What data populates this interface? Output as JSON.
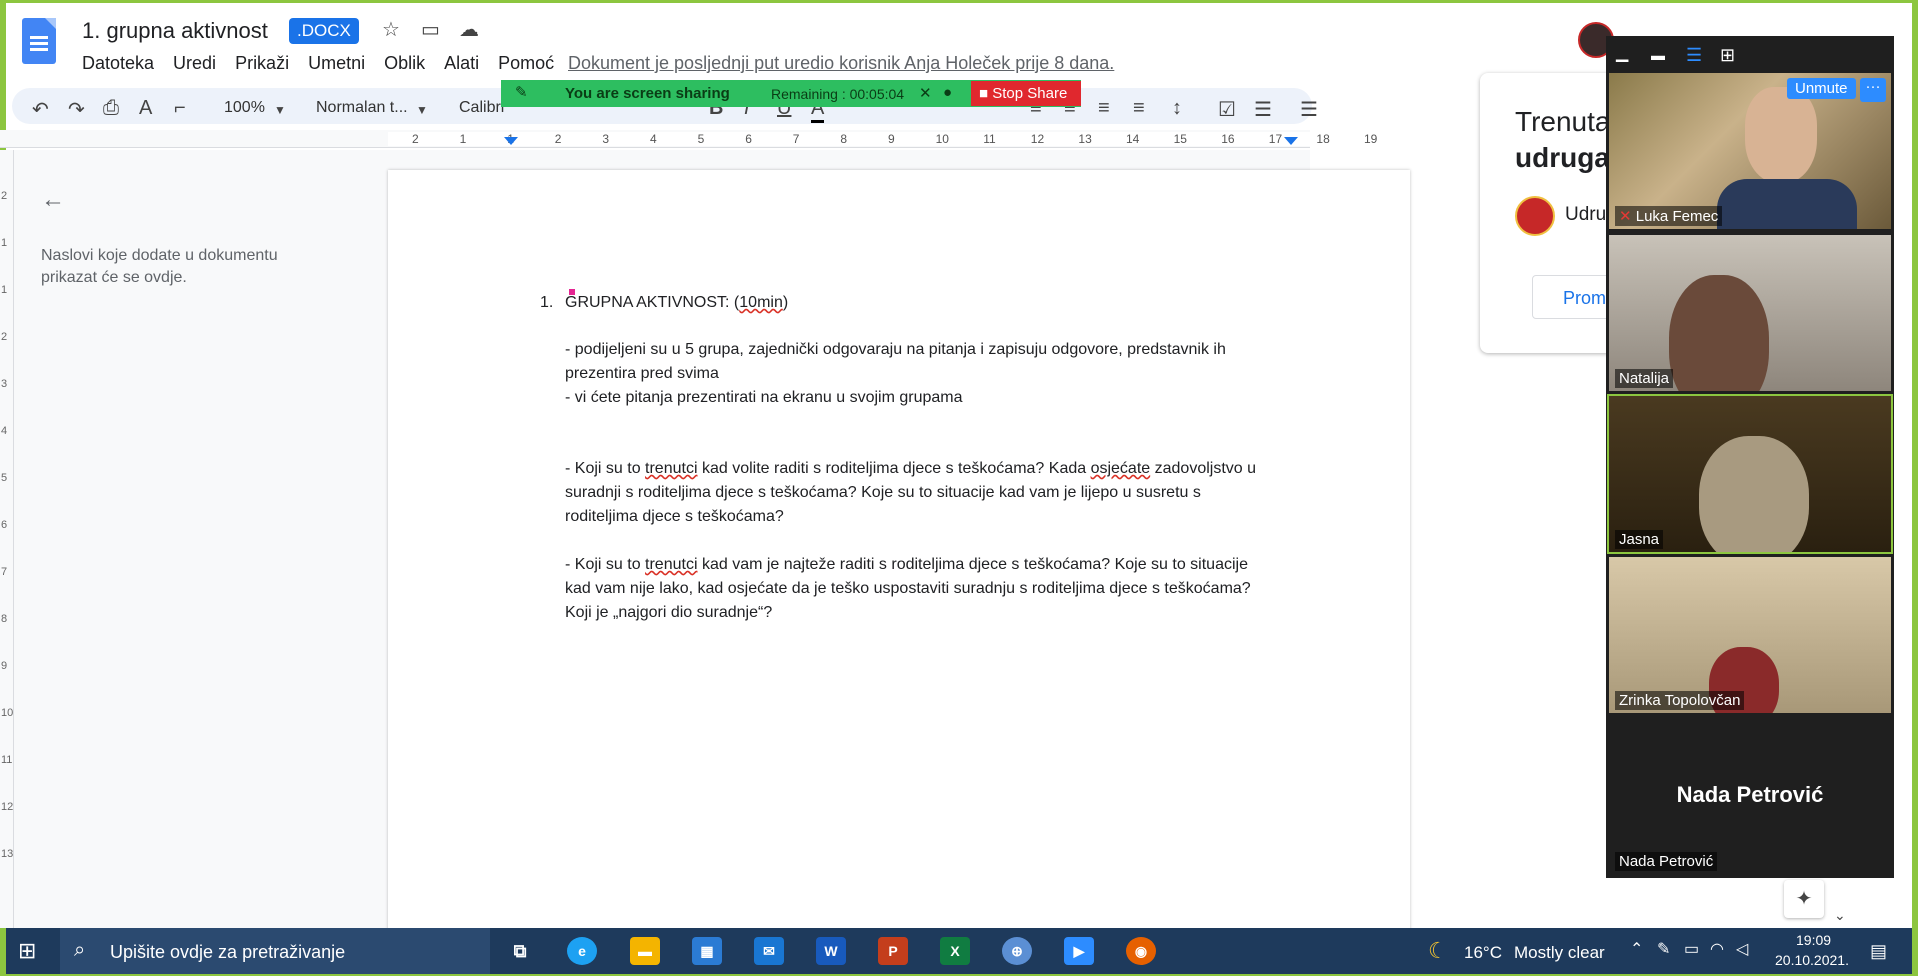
{
  "doc": {
    "title": "1. grupna aktivnost",
    "badge": ".DOCX",
    "last_edit": "Dokument je posljednji put uredio korisnik Anja Holeček prije 8 dana.",
    "menu": [
      "Datoteka",
      "Uredi",
      "Prikaži",
      "Umetni",
      "Oblik",
      "Alati",
      "Pomoć"
    ]
  },
  "toolbar": {
    "zoom": "100%",
    "style": "Normalan t...",
    "font": "Calibri"
  },
  "share": {
    "status": "You are screen sharing",
    "remaining": "Remaining : 00:05:04",
    "stop": "Stop Share"
  },
  "ruler": {
    "h": [
      "2",
      "1",
      "1",
      "2",
      "3",
      "4",
      "5",
      "6",
      "7",
      "8",
      "9",
      "10",
      "11",
      "12",
      "13",
      "14",
      "15",
      "16",
      "17",
      "18",
      "19"
    ],
    "v": [
      "2",
      "1",
      "1",
      "2",
      "3",
      "4",
      "5",
      "6",
      "7",
      "8",
      "9",
      "10",
      "11",
      "12",
      "13"
    ]
  },
  "outline_text": "Naslovi koje dodate u dokumentu prikazat će se ovdje.",
  "body": {
    "num": "1.",
    "heading_a": "GRUPNA AKTIVNOST: (",
    "heading_b": "10min",
    "heading_c": ")",
    "p1a": "- podijeljeni su u 5 grupa, zajednički odgovaraju na pitanja i zapisuju odgovore, predstavnik ih",
    "p1b": "prezentira pred svima",
    "p2": "- vi ćete pitanja prezentirati na ekranu u svojim grupama",
    "q1a_1": "- Koji su to ",
    "q1a_2": "trenutci",
    "q1a_3": " kad volite raditi s roditeljima djece s teškoćama? Kada ",
    "q1a_4": "osjećate",
    "q1a_5": " zadovoljstvo u",
    "q1b": "suradnji s roditeljima djece s teškoćama? Koje su to situacije kad vam je lijepo u susretu s",
    "q1c": "roditeljima djece s teškoćama?",
    "q2a_1": "- Koji su to ",
    "q2a_2": "trenutci",
    "q2a_3": " kad vam je najteže raditi s roditeljima djece s teškoćama? Koje su to situacije",
    "q2b": "kad vam nije lako, kad osjećate da je teško uspostaviti suradnju s roditeljima djece s teškoćama?",
    "q2c": "Koji je „najgori dio suradnje“?"
  },
  "panel": {
    "title1": "Trenuta",
    "title2": "udruga",
    "item": "Udru",
    "button": "Prom"
  },
  "zoom": {
    "unmute": "Unmute",
    "more": "···",
    "participants": [
      {
        "name": "Luka Femec"
      },
      {
        "name": "Natalija"
      },
      {
        "name": "Jasna"
      },
      {
        "name": "Zrinka Topolovčan"
      },
      {
        "name": "Nada Petrović",
        "big": "Nada Petrović"
      }
    ]
  },
  "taskbar": {
    "search": "Upišite ovdje za pretraživanje",
    "temp": "16°C",
    "weather": "Mostly clear",
    "time": "19:09",
    "date": "20.10.2021."
  },
  "colors": {
    "docs_blue": "#4285f4",
    "share_green": "#2dbe60",
    "stop_red": "#e0282e",
    "zoom_blue": "#2d8cff",
    "taskbar": "#1e3a5c"
  }
}
